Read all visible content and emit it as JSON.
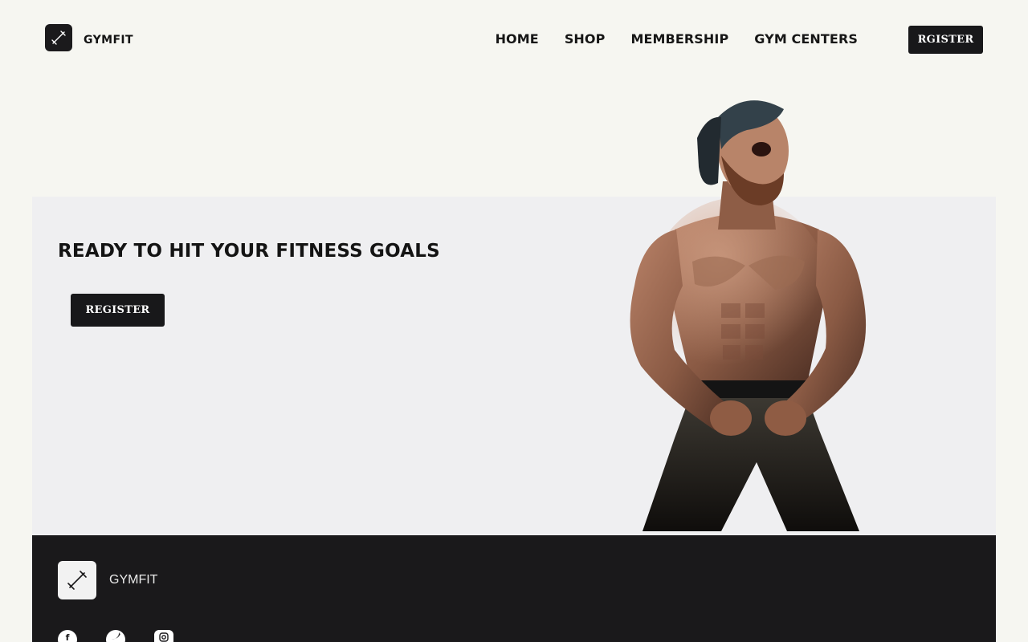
{
  "brand": {
    "name": "GYMFIT",
    "logo_icon": "dumbbell-diagonal-icon"
  },
  "nav": {
    "items": [
      {
        "label": "HOME"
      },
      {
        "label": "SHOP"
      },
      {
        "label": "MEMBERSHIP"
      },
      {
        "label": "GYM CENTERS"
      }
    ],
    "register_label": "RGISTER"
  },
  "hero": {
    "title": "READY TO HIT YOUR FITNESS GOALS",
    "register_label": "REGISTER"
  },
  "footer": {
    "brand_name": "GYMFIT",
    "socials": [
      "facebook-icon",
      "twitter-icon",
      "instagram-icon"
    ]
  },
  "colors": {
    "page_bg": "#f6f6f1",
    "hero_bg": "#efeff1",
    "dark": "#18181a",
    "footer_bg": "#1a191b"
  }
}
